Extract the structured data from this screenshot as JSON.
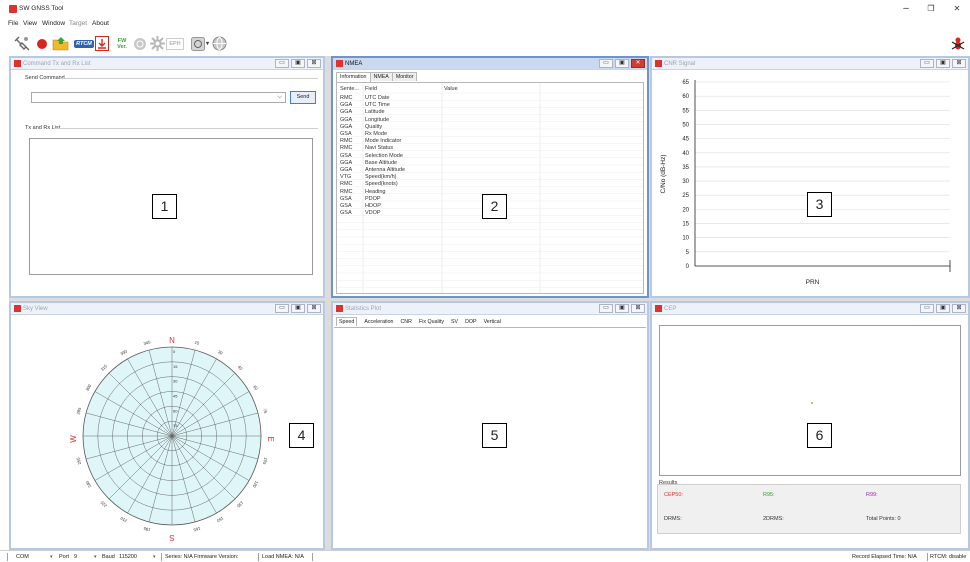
{
  "app": {
    "title": "SW GNSS Tool",
    "window_controls": {
      "minimize": "–",
      "restore": "❐",
      "close": "✕"
    }
  },
  "menu": [
    "File",
    "View",
    "Window",
    "Target",
    "About"
  ],
  "toolbar": {
    "rtcm": "RTCM",
    "fw_line1": "FW",
    "fw_line2": "Ver.",
    "eph": "EPH"
  },
  "panels": {
    "command": {
      "title": "Command Tx and Rx List",
      "send_command_label": "Send Command",
      "send_button": "Send",
      "dropdown_glyph": "⌵",
      "txrx_label": "Tx and Rx List",
      "marker": "1"
    },
    "nmea": {
      "title": "NMEA",
      "tabs": [
        "Information",
        "NMEA",
        "Monitor"
      ],
      "columns": [
        "Sente...",
        "Field",
        "Value"
      ],
      "rows": [
        {
          "s": "RMC",
          "f": "UTC Date"
        },
        {
          "s": "GGA",
          "f": "UTC Time"
        },
        {
          "s": "GGA",
          "f": "Latitude"
        },
        {
          "s": "GGA",
          "f": "Longitude"
        },
        {
          "s": "GGA",
          "f": "Quality"
        },
        {
          "s": "GSA",
          "f": "Rx Mode"
        },
        {
          "s": "RMC",
          "f": "Mode Indicator"
        },
        {
          "s": "RMC",
          "f": "Navi Status"
        },
        {
          "s": "GSA",
          "f": "Selection Mode"
        },
        {
          "s": "GGA",
          "f": "Base Altitude"
        },
        {
          "s": "GGA",
          "f": "Antenna Altitude"
        },
        {
          "s": "VTG",
          "f": "Speed(km/h)"
        },
        {
          "s": "RMC",
          "f": "Speed(knots)"
        },
        {
          "s": "RMC",
          "f": "Heading"
        },
        {
          "s": "GSA",
          "f": "PDOP"
        },
        {
          "s": "GSA",
          "f": "HDOP"
        },
        {
          "s": "GSA",
          "f": "VDOP"
        }
      ],
      "marker": "2"
    },
    "cnr": {
      "title": "CNR Signal",
      "marker": "3"
    },
    "sky": {
      "title": "Sky View",
      "marker": "4"
    },
    "stats": {
      "title": "Statistics Plot",
      "tabs": [
        "Speed",
        "Acceleration",
        "CNR",
        "Fix Quality",
        "SV",
        "DOP",
        "Vertical"
      ],
      "marker": "5"
    },
    "cep": {
      "title": "CEP",
      "results_label": "Results",
      "cep50": "CEP50:",
      "r95": "R95:",
      "r99": "R99:",
      "drms": "DRMS:",
      "twodrms": "2DRMS:",
      "total_points": "Total Points: 0",
      "colors": {
        "cep50": "#e0322d",
        "r95": "#2ca02c",
        "r99": "#9b2b9b"
      },
      "marker": "6"
    }
  },
  "chart_data": {
    "type": "bar",
    "ylabel": "C/No (dB-Hz)",
    "xlabel": "PRN",
    "ylim": [
      0,
      65
    ],
    "yticks": [
      65,
      60,
      55,
      50,
      45,
      40,
      35,
      30,
      25,
      20,
      15,
      10,
      5,
      0
    ],
    "categories": [],
    "values": [],
    "grid": true
  },
  "skyview": {
    "compass": {
      "N": "N",
      "E": "E",
      "S": "S",
      "W": "W"
    },
    "elevation_labels": [
      "0",
      "15",
      "30",
      "45",
      "60",
      "75"
    ],
    "azimuth_labels": [
      "15",
      "30",
      "45",
      "60",
      "75",
      "105",
      "120",
      "135",
      "150",
      "165",
      "195",
      "210",
      "225",
      "240",
      "255",
      "285",
      "300",
      "315",
      "330",
      "345"
    ],
    "compass_color": "#e0322d"
  },
  "statusbar": {
    "com": "COM",
    "port_label": "Port",
    "port_value": "9",
    "baud_label": "Baud",
    "baud_value": "115200",
    "info": "Series: N/A  Firmware Version:",
    "load_nmea": "Load NMEA: N/A",
    "elapsed": "Record Elapsed Time: N/A",
    "rtcm": "RTCM: disable"
  }
}
